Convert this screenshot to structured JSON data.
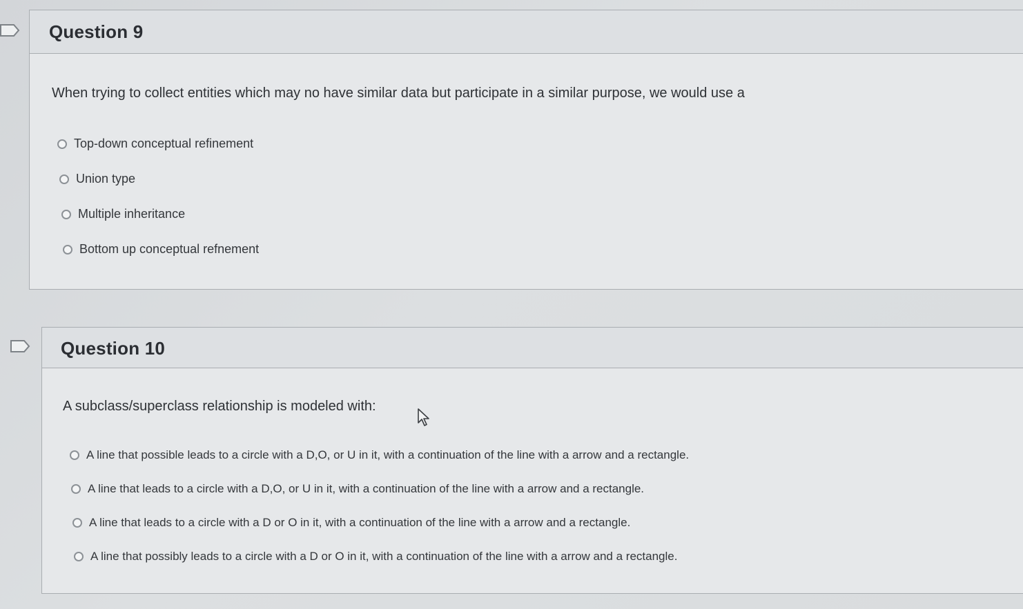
{
  "question9": {
    "title": "Question 9",
    "text": "When trying to collect entities which may no have similar data but participate in a similar purpose, we would use a",
    "options": [
      "Top-down conceptual refinement",
      "Union type",
      "Multiple inheritance",
      "Bottom up conceptual refnement"
    ]
  },
  "question10": {
    "title": "Question 10",
    "text": "A subclass/superclass relationship is modeled with:",
    "options": [
      "A line that possible leads to a circle with a D,O, or U in it, with a continuation of the line with a arrow and a rectangle.",
      "A line that leads to a circle with a D,O, or U in it, with a continuation of the line with a arrow and a rectangle.",
      "A line that leads to a circle with a D or O in it, with a continuation of the line with a arrow and a rectangle.",
      "A line that possibly leads to a circle with a D or O in it, with a continuation of the line with a arrow and a rectangle."
    ]
  },
  "icons": {
    "flag": "flag-icon",
    "radio": "radio-button-icon",
    "cursor": "mouse-pointer-icon"
  }
}
